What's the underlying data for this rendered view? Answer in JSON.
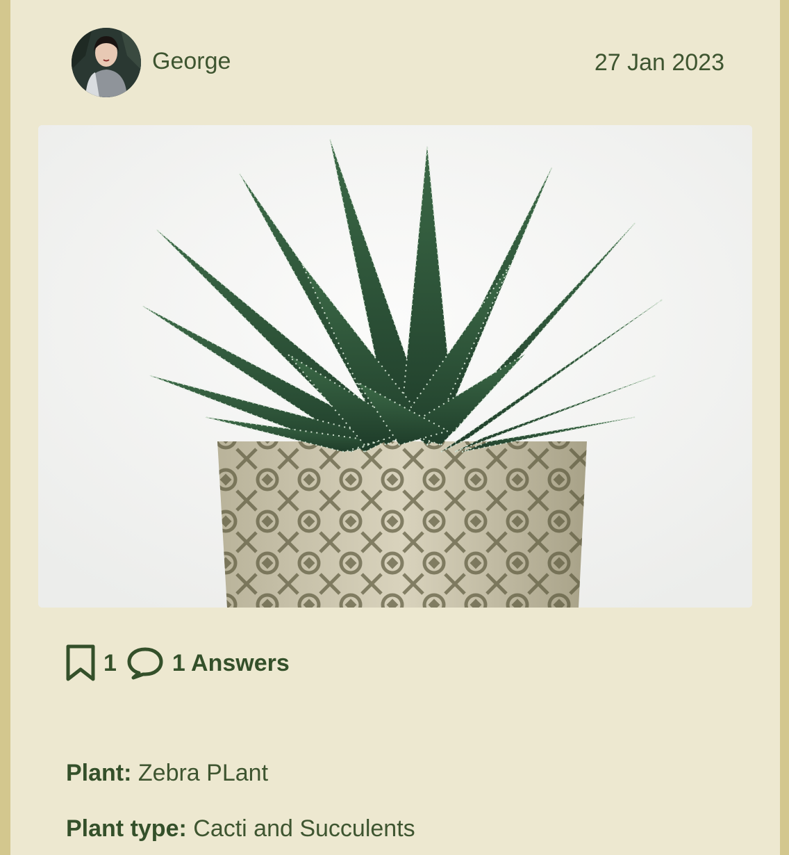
{
  "post": {
    "author": "George",
    "date": "27 Jan 2023",
    "avatar_icon": "user-avatar-photo",
    "image_icon": "succulent-photo"
  },
  "stats": {
    "bookmark_count": "1",
    "answers_label": "1 Answers"
  },
  "details": {
    "plant_label": "Plant:",
    "plant_value": " Zebra PLant",
    "type_label": "Plant type:",
    "type_value": " Cacti and Succulents"
  },
  "colors": {
    "background": "#ede8d0",
    "border": "#d3c78e",
    "text": "#34502a"
  }
}
